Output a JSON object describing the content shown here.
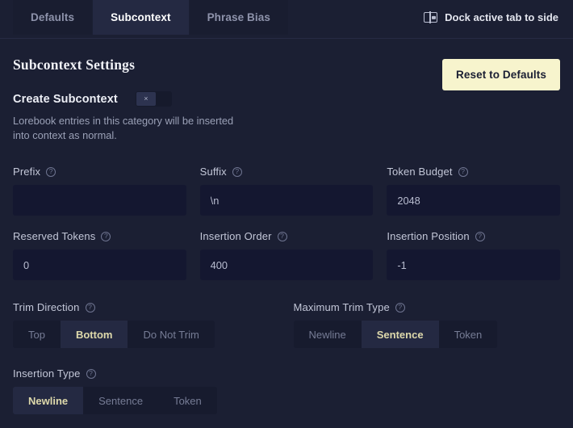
{
  "tabs": [
    {
      "label": "Defaults",
      "active": false
    },
    {
      "label": "Subcontext",
      "active": true
    },
    {
      "label": "Phrase Bias",
      "active": false
    }
  ],
  "dock": {
    "label": "Dock active tab to side",
    "icon": "dock-to-side-icon"
  },
  "header": {
    "title": "Subcontext Settings",
    "reset_label": "Reset to Defaults"
  },
  "create_subcontext": {
    "label": "Create Subcontext",
    "toggle_state": "off",
    "toggle_glyph": "×",
    "description": "Lorebook entries in this category will be inserted into context as normal."
  },
  "help_glyph": "?",
  "fields": [
    {
      "name": "prefix",
      "label": "Prefix",
      "value": "",
      "placeholder": ""
    },
    {
      "name": "suffix",
      "label": "Suffix",
      "value": "\\n",
      "placeholder": ""
    },
    {
      "name": "token-budget",
      "label": "Token Budget",
      "value": "2048",
      "placeholder": ""
    },
    {
      "name": "reserved-tokens",
      "label": "Reserved Tokens",
      "value": "0",
      "placeholder": ""
    },
    {
      "name": "insertion-order",
      "label": "Insertion Order",
      "value": "400",
      "placeholder": ""
    },
    {
      "name": "insertion-position",
      "label": "Insertion Position",
      "value": "-1",
      "placeholder": ""
    }
  ],
  "segment_groups": [
    {
      "name": "trim-direction",
      "label": "Trim Direction",
      "options": [
        {
          "label": "Top",
          "selected": false
        },
        {
          "label": "Bottom",
          "selected": true
        },
        {
          "label": "Do Not Trim",
          "selected": false
        }
      ]
    },
    {
      "name": "maximum-trim-type",
      "label": "Maximum Trim Type",
      "options": [
        {
          "label": "Newline",
          "selected": false
        },
        {
          "label": "Sentence",
          "selected": true
        },
        {
          "label": "Token",
          "selected": false
        }
      ]
    },
    {
      "name": "insertion-type",
      "label": "Insertion Type",
      "options": [
        {
          "label": "Newline",
          "selected": true
        },
        {
          "label": "Sentence",
          "selected": false
        },
        {
          "label": "Token",
          "selected": false
        }
      ]
    }
  ],
  "colors": {
    "background": "#1b1f33",
    "tab_active_bg": "#242942",
    "tab_inactive_bg": "#191d30",
    "input_bg": "#141730",
    "accent_button": "#f7f4cd",
    "segment_selected_text": "#ded9ab"
  }
}
